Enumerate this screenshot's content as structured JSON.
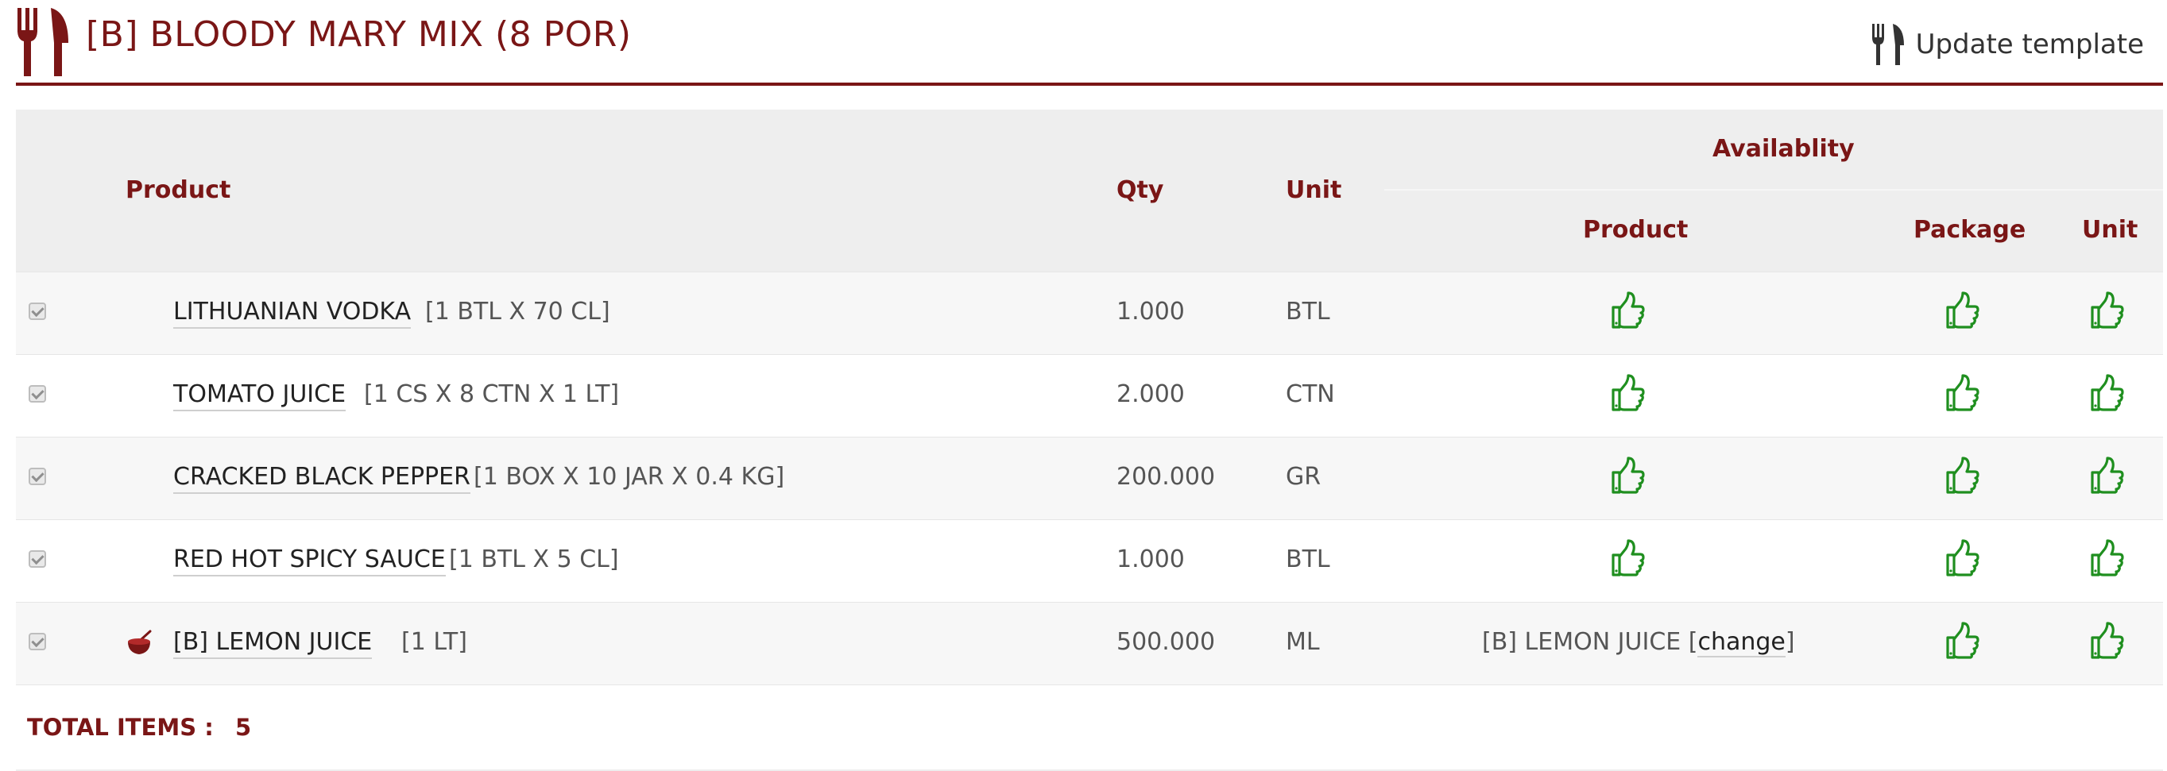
{
  "header": {
    "title": "[B] BLOODY MARY MIX (8 POR)",
    "logo_icon": "utensils-icon",
    "update_label": "Update template",
    "update_icon": "utensils-icon",
    "accent_color": "#7a1616"
  },
  "table": {
    "headers": {
      "product": "Product",
      "qty": "Qty",
      "unit": "Unit",
      "availability": "Availablity",
      "avail_product": "Product",
      "avail_package": "Package",
      "avail_unit": "Unit"
    },
    "rows": [
      {
        "name": "LITHUANIAN VODKA",
        "desc": "[1 BTL X 70 CL]",
        "qty": "1.000",
        "unit": "BTL",
        "checked": true,
        "avail_product_ok": true
      },
      {
        "name": "TOMATO JUICE",
        "desc": "[1 CS X 8 CTN X 1 LT]",
        "qty": "2.000",
        "unit": "CTN",
        "checked": true,
        "avail_product_ok": true
      },
      {
        "name": "CRACKED BLACK PEPPER",
        "desc": "[1 BOX X 10 JAR X 0.4 KG]",
        "qty": "200.000",
        "unit": "GR",
        "checked": true,
        "avail_product_ok": true
      },
      {
        "name": "RED HOT SPICY SAUCE",
        "desc": "[1 BTL X 5 CL]",
        "qty": "1.000",
        "unit": "BTL",
        "checked": true,
        "avail_product_ok": true
      },
      {
        "name": "[B] LEMON JUICE",
        "desc": "[1 LT]",
        "qty": "500.000",
        "unit": "ML",
        "checked": true,
        "icon": "bowl-icon",
        "avail_text_prefix": "[B] LEMON JUICE [",
        "avail_text_link": "change",
        "avail_text_suffix": "]"
      }
    ],
    "ok_icon": "thumbs-up-icon",
    "ok_color": "#1f8f1f"
  },
  "total": {
    "label": "TOTAL ITEMS :",
    "value": "5"
  }
}
